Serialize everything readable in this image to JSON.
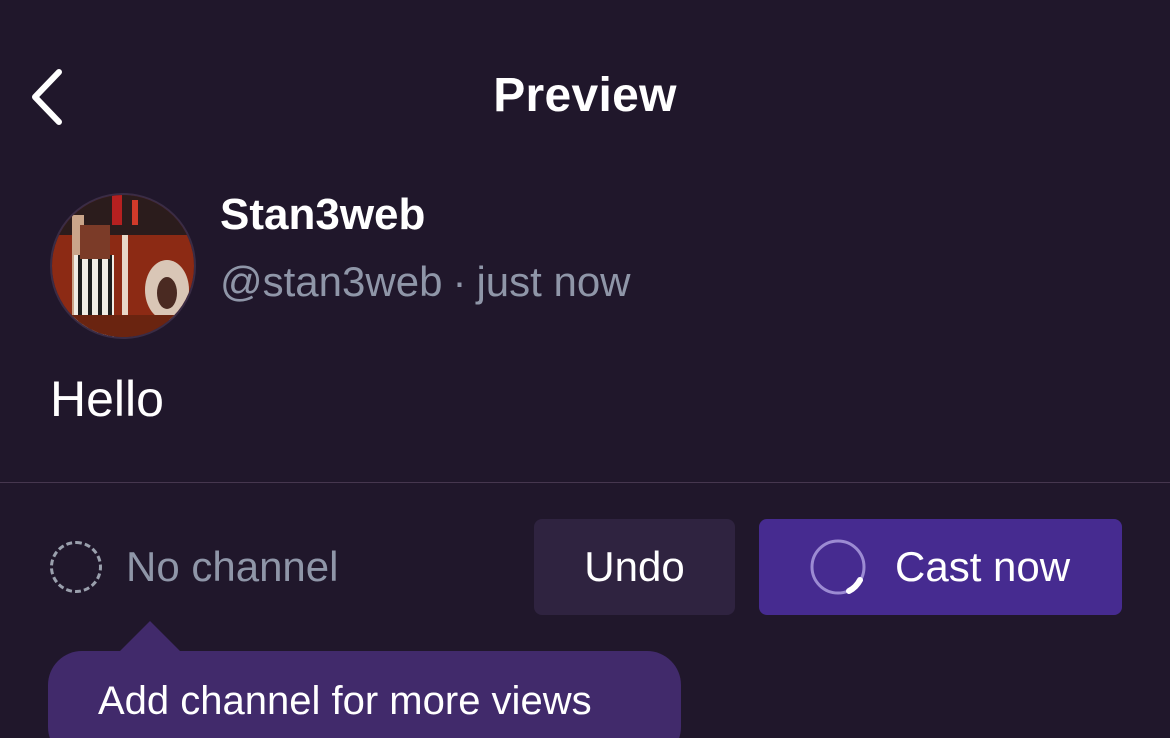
{
  "header": {
    "back_icon": "chevron-left-icon",
    "title": "Preview"
  },
  "post": {
    "author": {
      "display_name": "Stan3web",
      "handle": "@stan3web",
      "separator": "·",
      "timestamp": "just now",
      "avatar_icon": "avatar-image"
    },
    "text": "Hello"
  },
  "footer": {
    "channel": {
      "icon": "dashed-circle-icon",
      "label": "No channel"
    },
    "undo_label": "Undo",
    "cast": {
      "icon": "spinner-icon",
      "label": "Cast now"
    },
    "tooltip": "Add channel for more views"
  },
  "colors": {
    "background": "#20172b",
    "muted_text": "#8f96a8",
    "undo_bg": "#2f2340",
    "primary": "#462b90",
    "tooltip_bg": "#412a6b"
  }
}
